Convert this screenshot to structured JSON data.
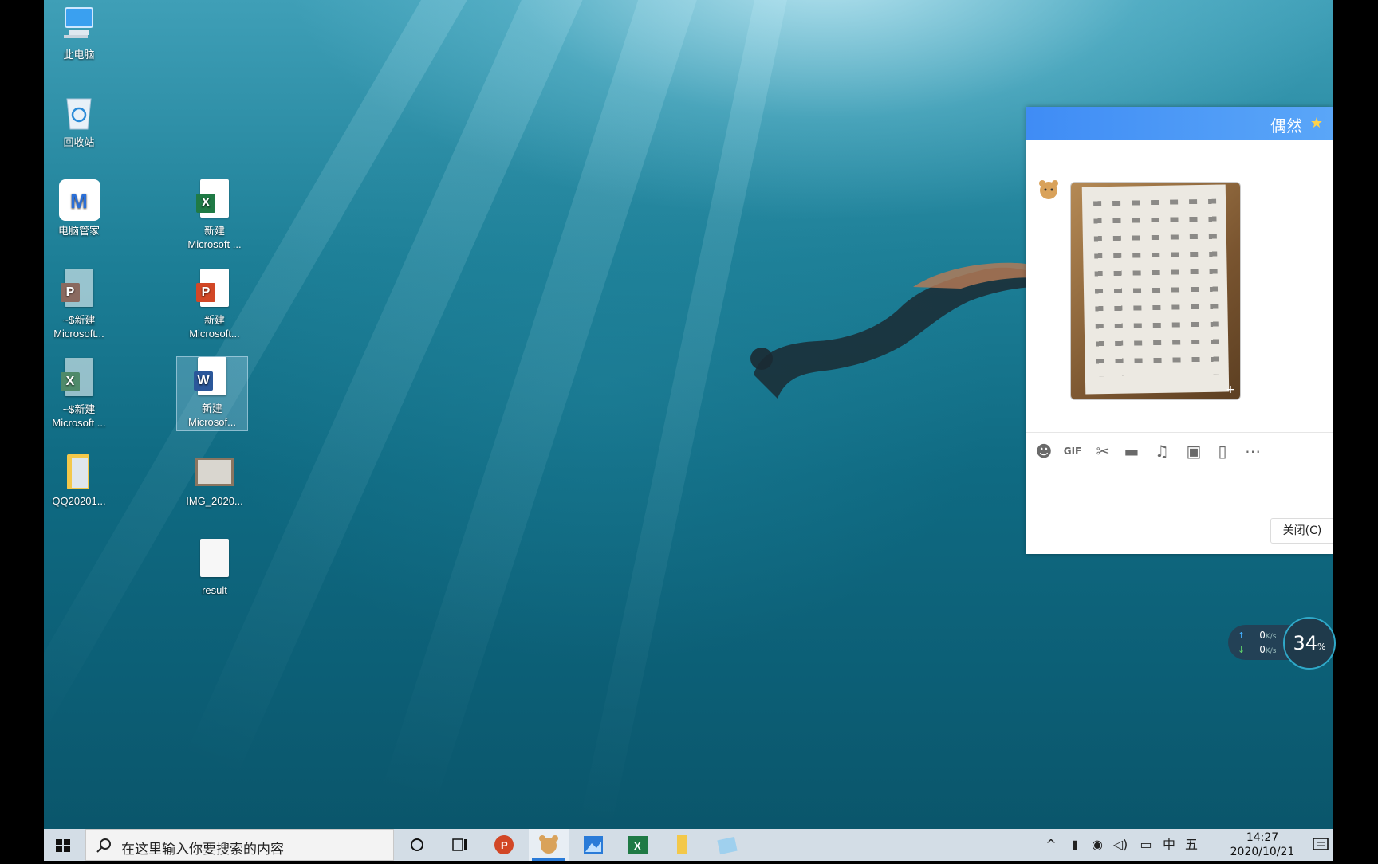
{
  "desktop": {
    "icons": [
      {
        "label": "此电脑",
        "icon": "computer-icon"
      },
      {
        "label": "回收站",
        "icon": "recycle-bin-icon"
      },
      {
        "label": "电脑管家",
        "icon": "pc-manager-icon"
      },
      {
        "label": "新建\nMicrosoft ...",
        "icon": "excel-file-icon"
      },
      {
        "label": "~$新建\nMicrosoft...",
        "icon": "powerpoint-temp-file-icon"
      },
      {
        "label": "新建\nMicrosoft...",
        "icon": "powerpoint-file-icon"
      },
      {
        "label": "~$新建\nMicrosoft ...",
        "icon": "excel-temp-file-icon"
      },
      {
        "label": "新建\nMicrosof...",
        "icon": "word-file-icon"
      },
      {
        "label": "QQ20201...",
        "icon": "folder-icon"
      },
      {
        "label": "IMG_2020...",
        "icon": "image-file-icon"
      },
      {
        "label": "result",
        "icon": "text-file-icon"
      }
    ]
  },
  "chat": {
    "title": "偶然",
    "title_icon": "star-icon",
    "toolbar_icons": [
      "emoji-icon",
      "gif-icon",
      "screenshot-scissors-icon",
      "folder-icon",
      "music-icon",
      "image-icon",
      "shake-icon",
      "more-icon"
    ],
    "gif_label": "GIF",
    "close_label": "关闭(C)"
  },
  "net_widget": {
    "upload": "0",
    "download": "0",
    "unit": "K/s",
    "cpu_percent": "34",
    "percent_sign": "%"
  },
  "taskbar": {
    "search_placeholder": "在这里输入你要搜索的内容",
    "ime_lang": "中",
    "ime_mode": "五",
    "time": "14:27",
    "date": "2020/10/21"
  },
  "colors": {
    "accent": "#2a7bd8",
    "chat_header": "#4a99f7",
    "excel": "#1f7a45",
    "powerpoint": "#d24726",
    "word": "#2b579a"
  }
}
